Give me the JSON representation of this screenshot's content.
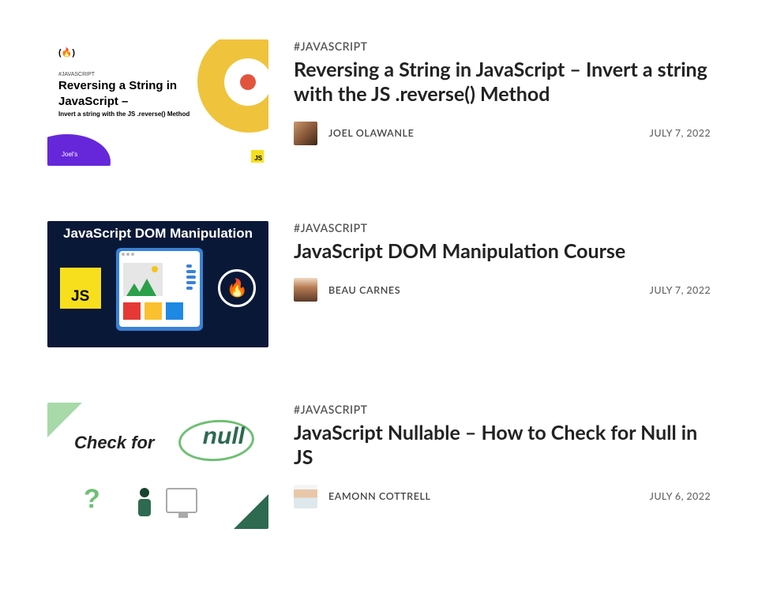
{
  "articles": [
    {
      "tag": "#JAVASCRIPT",
      "title": "Reversing a String in JavaScript – Invert a string with the JS .reverse() Method",
      "author": "JOEL OLAWANLE",
      "date": "JULY 7, 2022",
      "thumb": {
        "small_tag": "#JAVASCRIPT",
        "headline1": "Reversing a String in",
        "headline2": "JavaScript –",
        "sub": "Invert a string with the JS .reverse() Method",
        "badge": "Joel's",
        "js_label": "JS",
        "logo": "(🔥)"
      }
    },
    {
      "tag": "#JAVASCRIPT",
      "title": "JavaScript DOM Manipulation Course",
      "author": "BEAU CARNES",
      "date": "JULY 7, 2022",
      "thumb": {
        "heading": "JavaScript DOM Manipulation",
        "js_label": "JS",
        "fcc": "🔥"
      }
    },
    {
      "tag": "#JAVASCRIPT",
      "title": "JavaScript Nullable – How to Check for Null in JS",
      "author": "EAMONN COTTRELL",
      "date": "JULY 6, 2022",
      "thumb": {
        "text": "Check for",
        "null": "null",
        "q": "?"
      }
    }
  ]
}
